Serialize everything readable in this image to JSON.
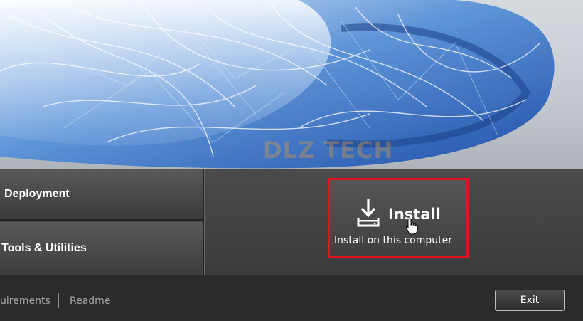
{
  "hero": {
    "watermark": "DLZ TECH"
  },
  "nav": {
    "deployment": "Deployment",
    "tools": "Tools & Utilities"
  },
  "install": {
    "title": "Install",
    "subtitle": "Install on this computer",
    "icon": "download-icon"
  },
  "footer": {
    "requirements": "uirements",
    "readme": "Readme",
    "exit": "Exit"
  },
  "colors": {
    "highlight_border": "#e0141e",
    "panel": "#3d3d3d",
    "footer": "#2b2b2b"
  }
}
